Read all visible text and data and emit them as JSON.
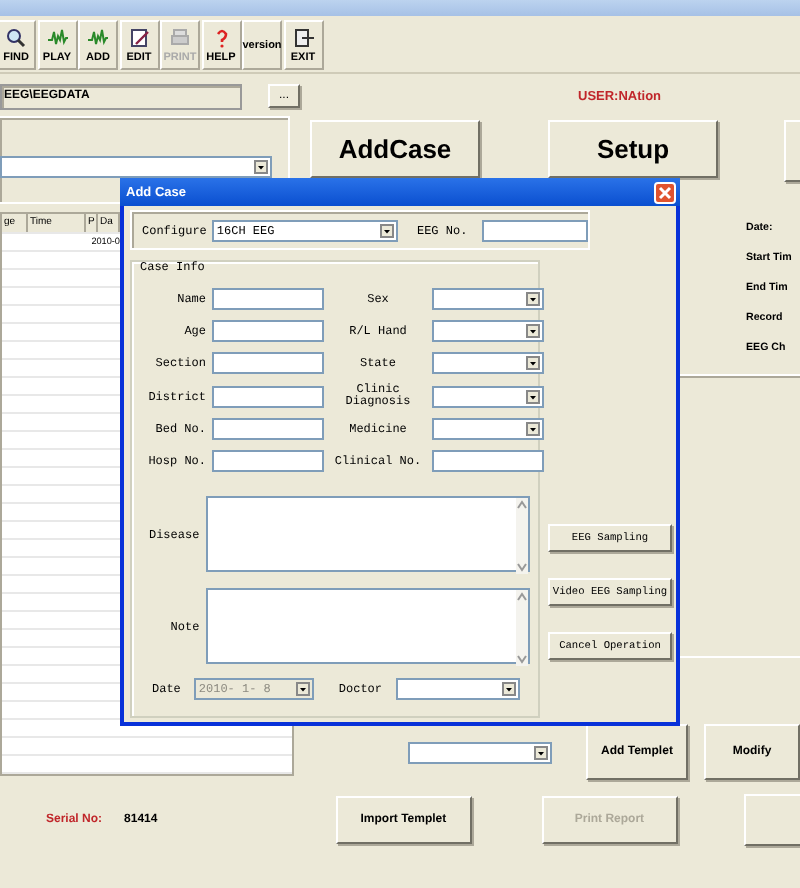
{
  "toolbar": [
    {
      "label": "FIND",
      "kind": "search",
      "disabled": false
    },
    {
      "label": "PLAY",
      "kind": "wave",
      "disabled": false
    },
    {
      "label": "ADD",
      "kind": "wave",
      "disabled": false
    },
    {
      "label": "EDIT",
      "kind": "edit",
      "disabled": false
    },
    {
      "label": "PRINT",
      "kind": "print",
      "disabled": true
    },
    {
      "label": "HELP",
      "kind": "help",
      "disabled": false
    },
    {
      "label": "version",
      "kind": "none",
      "disabled": false
    },
    {
      "label": "EXIT",
      "kind": "exit",
      "disabled": false
    }
  ],
  "path_field": {
    "value": "EEG\\EEGDATA"
  },
  "browse_button": "...",
  "user_label": "USER:NAtion",
  "main_buttons": [
    "AddCase",
    "Setup"
  ],
  "table": {
    "columns": [
      "ge",
      "Time",
      "P",
      "Da"
    ],
    "rows": [
      [
        "",
        "",
        "",
        "2010-0"
      ]
    ]
  },
  "record_info": [
    "Date:",
    "Start Tim",
    "End Tim",
    "Record",
    "EEG Ch"
  ],
  "template_buttons": [
    "Add Templet",
    "Modify"
  ],
  "serial": {
    "label": "Serial No:",
    "value": "81414"
  },
  "bottom_buttons": [
    {
      "label": "Import Templet",
      "disabled": false
    },
    {
      "label": "Print Report",
      "disabled": true
    }
  ],
  "dialog": {
    "title": "Add Case",
    "configure": {
      "label": "Configure",
      "value": "16CH EEG"
    },
    "eeg_no": {
      "label": "EEG No."
    },
    "case_info": {
      "title": "Case Info",
      "left_fields": [
        {
          "label": "Name",
          "kind": "text"
        },
        {
          "label": "Age",
          "kind": "text"
        },
        {
          "label": "Section",
          "kind": "text"
        },
        {
          "label": "District",
          "kind": "text"
        },
        {
          "label": "Bed No.",
          "kind": "text"
        },
        {
          "label": "Hosp No.",
          "kind": "text"
        }
      ],
      "right_fields": [
        {
          "label": "Sex",
          "kind": "select"
        },
        {
          "label": "R/L Hand",
          "kind": "select"
        },
        {
          "label": "State",
          "kind": "select"
        },
        {
          "label": "Clinic Diagnosis",
          "kind": "select"
        },
        {
          "label": "Medicine",
          "kind": "select"
        },
        {
          "label": "Clinical No.",
          "kind": "text"
        }
      ],
      "disease": {
        "label": "Disease"
      },
      "note": {
        "label": "Note"
      },
      "date": {
        "label": "Date",
        "value": "2010- 1- 8",
        "disabled": true
      },
      "doctor": {
        "label": "Doctor"
      }
    },
    "actions": [
      "EEG Sampling",
      "Video EEG Sampling",
      "Cancel Operation"
    ]
  }
}
